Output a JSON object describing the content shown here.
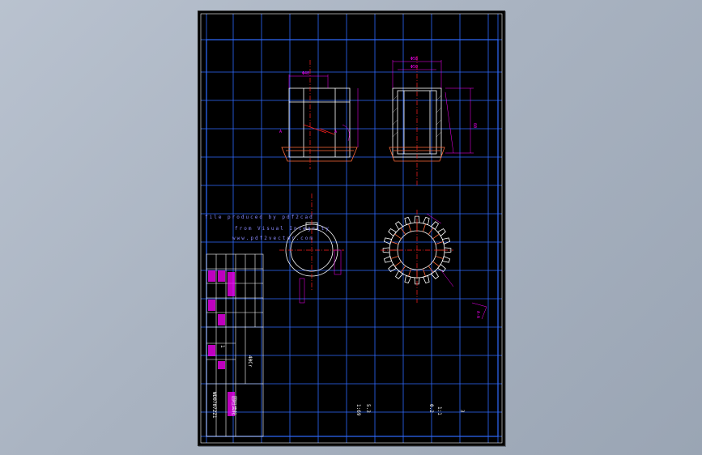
{
  "drawing": {
    "background_color": "#000000",
    "grid_color": "#2f6bff",
    "geometry_color": "#ffffff",
    "dimension_color": "#ff00ff",
    "centerline_color": "#ff2020",
    "watermark": {
      "line1": "file produced by pdf2cad",
      "line2": "from Visual Integrity",
      "line3": "www.pdf2vector.com"
    },
    "dimensions": {
      "top_left_width": "Φ40",
      "top_right_outer": "Φ58",
      "top_right_inner": "Φ50",
      "right_height": "60"
    },
    "section_marks": {
      "section_a_left": "A",
      "section_a_right": "A",
      "view_label": "A-A"
    },
    "title_block": {
      "drawing_number": "WD07072Z1",
      "part_name": "圆柱齿轮",
      "material": "40Cr",
      "scale": "1:1",
      "quantity": "1",
      "weight": "0.2",
      "sheet": "3",
      "ratio_label": "1:69",
      "date_note": "5.3"
    }
  }
}
